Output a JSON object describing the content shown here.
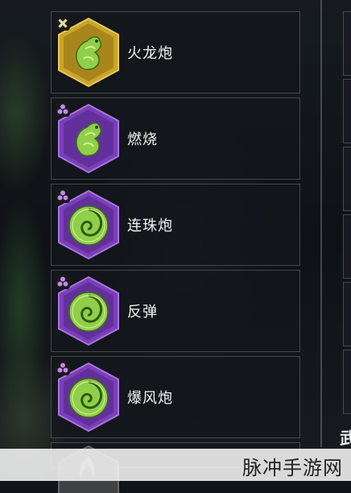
{
  "skills": [
    {
      "label": "火龙炮",
      "tier": "gold",
      "badge": "cross-badge-icon",
      "icon": "dragon-icon"
    },
    {
      "label": "燃烧",
      "tier": "purple",
      "badge": "trefoil-badge-icon",
      "icon": "dragon-icon"
    },
    {
      "label": "连珠炮",
      "tier": "purple",
      "badge": "trefoil-badge-icon",
      "icon": "swirl-icon"
    },
    {
      "label": "反弹",
      "tier": "purple",
      "badge": "trefoil-badge-icon",
      "icon": "swirl-icon"
    },
    {
      "label": "爆风炮",
      "tier": "purple",
      "badge": "trefoil-badge-icon",
      "icon": "swirl-icon"
    }
  ],
  "right_panel": {
    "partial_text": "武"
  },
  "watermark": "脉冲手游网",
  "colors": {
    "gold": "#c9a52a",
    "purple": "#7a3fb8",
    "jade": "#8fcf4a"
  }
}
